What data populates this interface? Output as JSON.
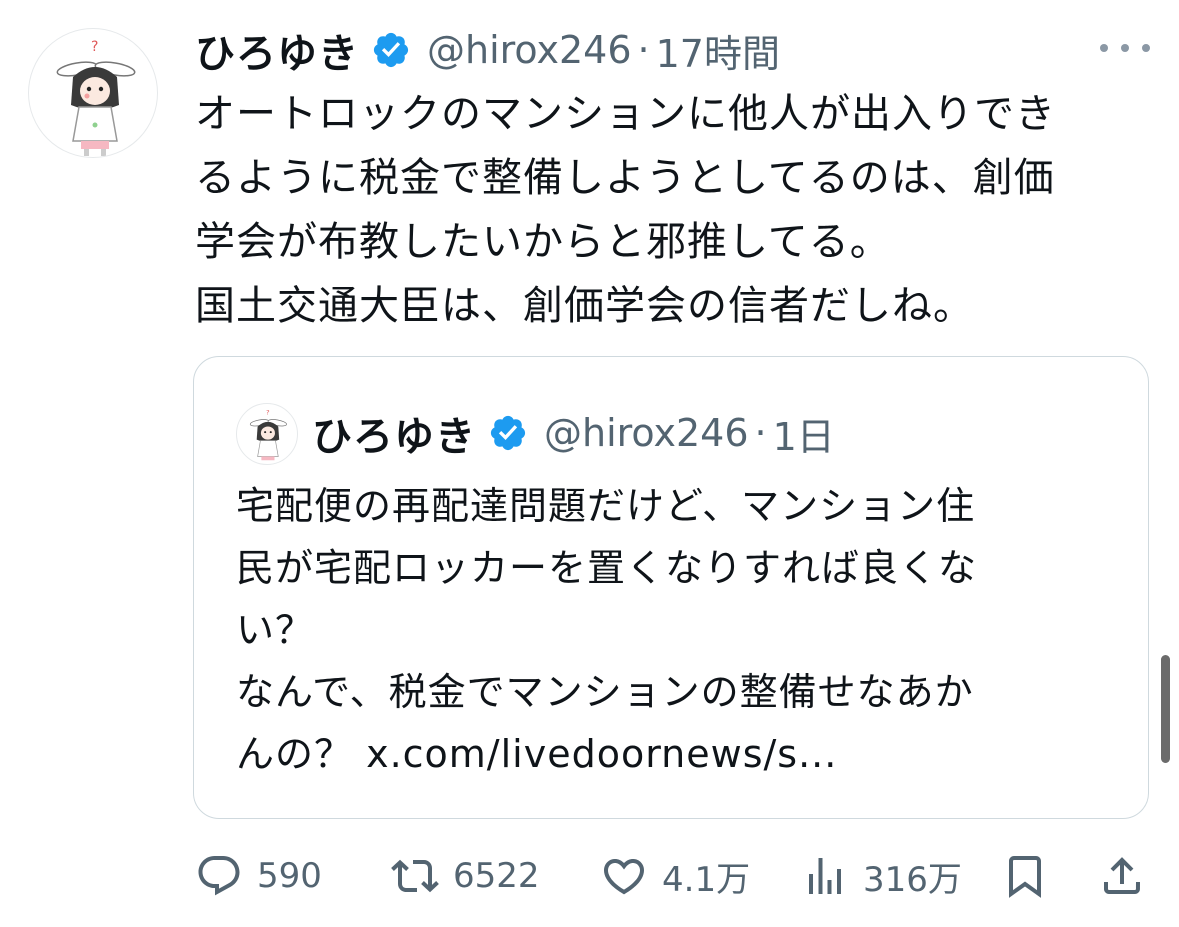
{
  "tweet": {
    "author": {
      "name": "ひろゆき",
      "handle": "@hirox246",
      "verified": true
    },
    "separator": "·",
    "time": "17時間",
    "more_icon": "more-horizontal-icon",
    "text_lines": [
      "オートロックのマンションに他人が出入りでき",
      "るように税金で整備しようとしてるのは、創価",
      "学会が布教したいからと邪推してる。",
      "国土交通大臣は、創価学会の信者だしね。"
    ]
  },
  "quoted": {
    "author": {
      "name": "ひろゆき",
      "handle": "@hirox246",
      "verified": true
    },
    "separator": "·",
    "time": "1日",
    "text_lines": [
      "宅配便の再配達問題だけど、マンション住",
      "民が宅配ロッカーを置くなりすれば良くな",
      "い？",
      "なんで、税金でマンションの整備せなあか",
      "んの？ x.com/livedoornews/s..."
    ]
  },
  "actions": {
    "reply": {
      "icon": "reply-icon",
      "count": "590"
    },
    "retweet": {
      "icon": "retweet-icon",
      "count": "6522"
    },
    "like": {
      "icon": "like-icon",
      "count": "4.1万"
    },
    "views": {
      "icon": "views-icon",
      "count": "316万"
    },
    "bookmark": {
      "icon": "bookmark-icon"
    },
    "share": {
      "icon": "share-icon"
    }
  },
  "colors": {
    "text": "#0f1419",
    "secondary": "#536471",
    "verified_badge": "#1d9bf0",
    "border": "#cfd9de"
  }
}
